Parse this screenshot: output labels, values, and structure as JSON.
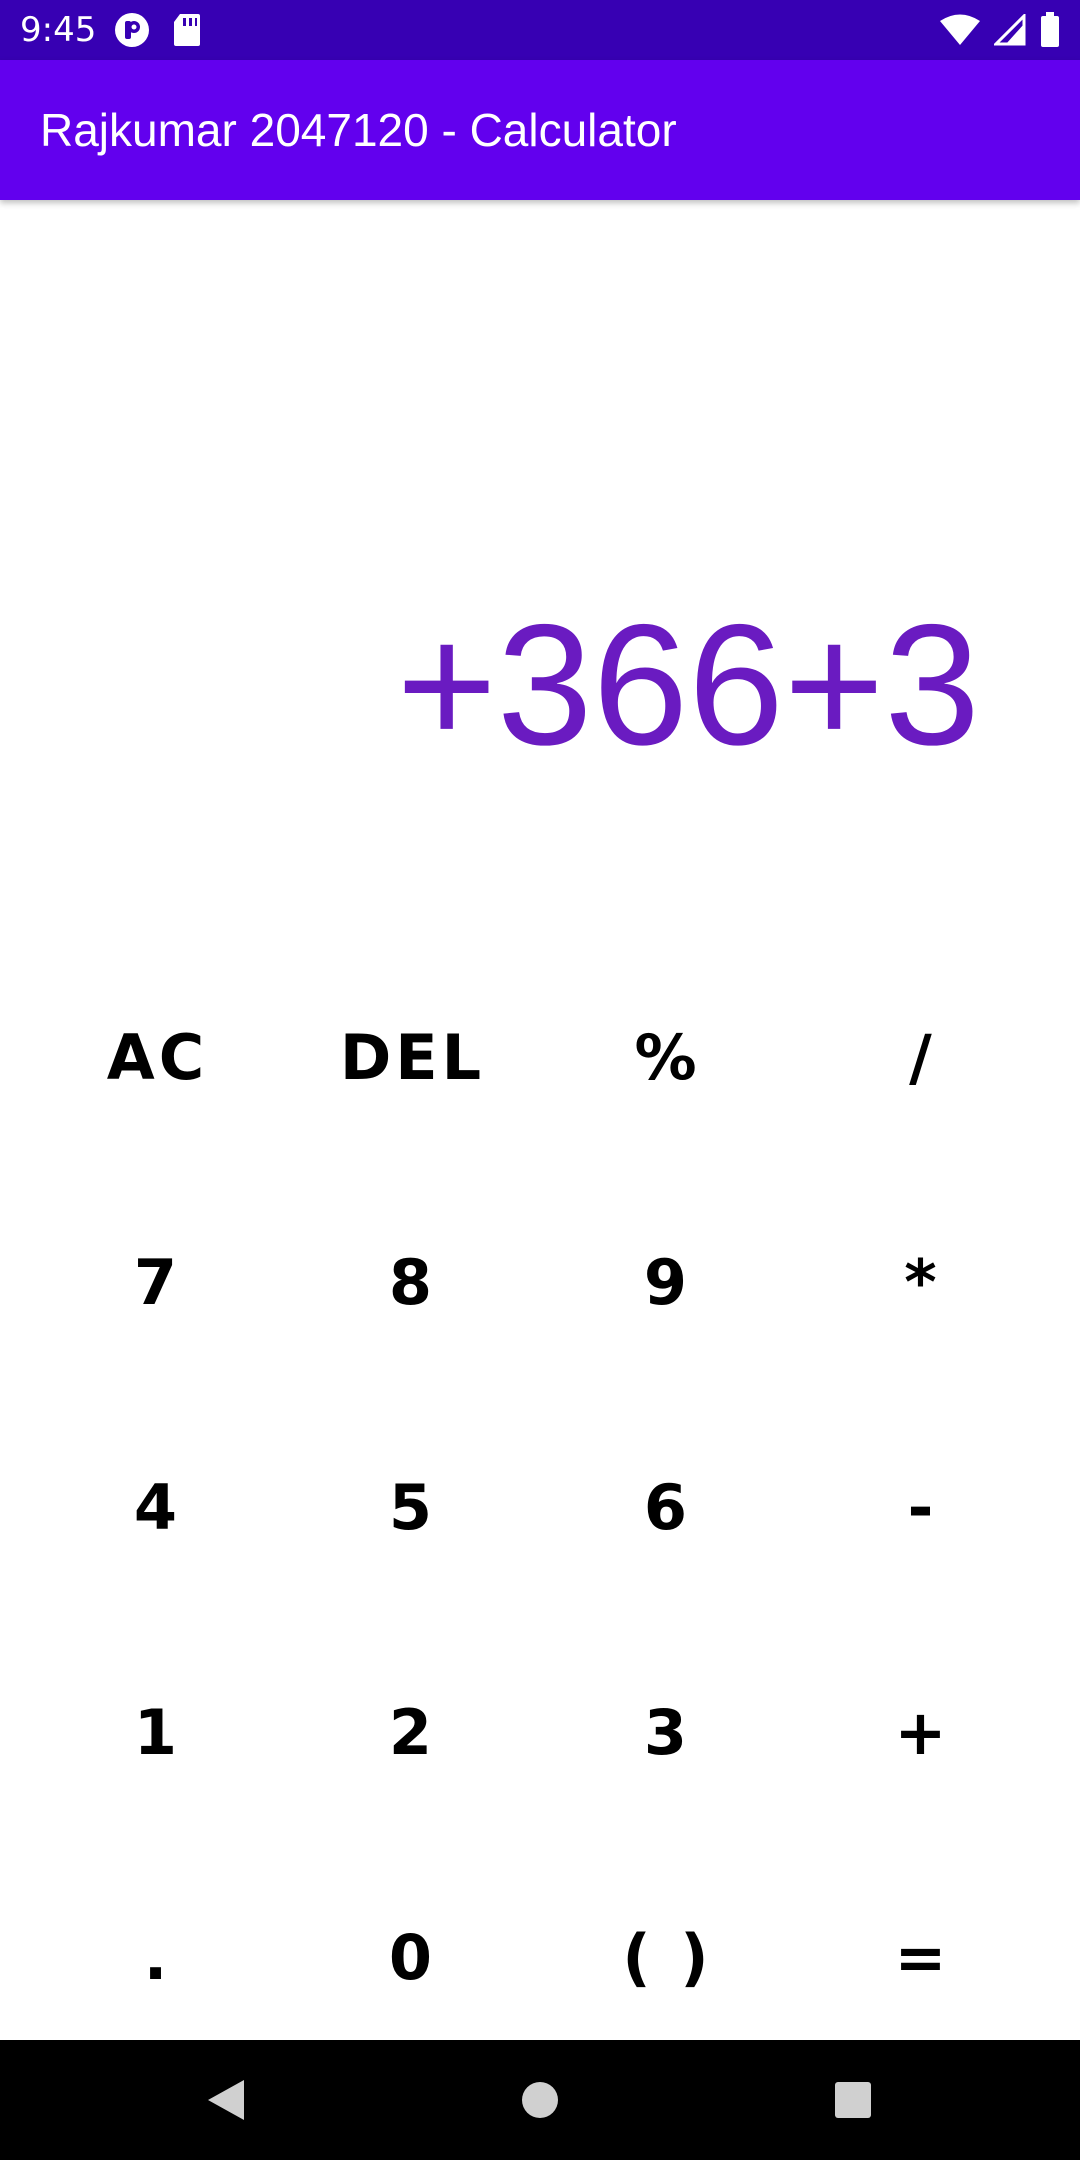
{
  "status_bar": {
    "time": "9:45",
    "left_icons": [
      "p-notification-icon",
      "sd-card-icon"
    ],
    "right_icons": [
      "wifi-icon",
      "cell-signal-icon",
      "battery-icon"
    ],
    "background_color": "#3700b3"
  },
  "app_bar": {
    "title": "Rajkumar 2047120 - Calculator",
    "background_color": "#6200ee"
  },
  "display": {
    "expression": "+366+3",
    "text_color": "#6a1bc1"
  },
  "keypad": {
    "rows": [
      [
        "AC",
        "DEL",
        "%",
        "/"
      ],
      [
        "7",
        "8",
        "9",
        "*"
      ],
      [
        "4",
        "5",
        "6",
        "-"
      ],
      [
        "1",
        "2",
        "3",
        "+"
      ],
      [
        ".",
        "0",
        "( )",
        "="
      ]
    ]
  },
  "nav_bar": {
    "buttons": [
      "back-icon",
      "home-icon",
      "recents-icon"
    ]
  }
}
